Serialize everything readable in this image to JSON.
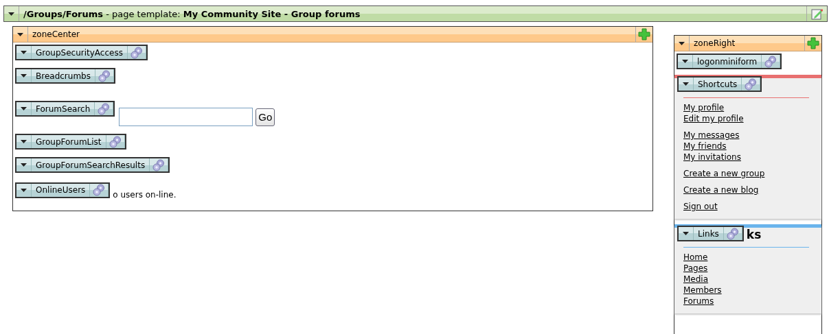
{
  "page": {
    "path": "/Groups/Forums",
    "template_label": " - page template: ",
    "template_name": "My Community Site - Group forums"
  },
  "zone_center": {
    "title": "zoneCenter",
    "webparts": [
      {
        "name": "GroupSecurityAccess",
        "kind": "plain"
      },
      {
        "name": "Breadcrumbs",
        "kind": "plain"
      },
      {
        "name": "ForumSearch",
        "kind": "search",
        "button": "Go"
      },
      {
        "name": "GroupForumList",
        "kind": "plain"
      },
      {
        "name": "GroupForumSearchResults",
        "kind": "plain"
      },
      {
        "name": "OnlineUsers",
        "kind": "text",
        "text": "o users on-line."
      }
    ]
  },
  "zone_right": {
    "title": "zoneRight",
    "webparts": [
      {
        "name": "logonminiform",
        "kind": "plain"
      },
      {
        "name": "Shortcuts",
        "kind": "links",
        "color": "#e87070",
        "groups": [
          [
            "My profile",
            "Edit my profile"
          ],
          [
            "My messages",
            "My friends",
            "My invitations"
          ],
          [
            "Create a new group"
          ],
          [
            "Create a new blog"
          ],
          [
            "Sign out"
          ]
        ]
      },
      {
        "name": "Links",
        "kind": "links",
        "color": "#6ab4ec",
        "heading": "ks",
        "groups": [
          [
            "Home",
            "Pages",
            "Media",
            "Members",
            "Forums"
          ]
        ]
      }
    ]
  }
}
